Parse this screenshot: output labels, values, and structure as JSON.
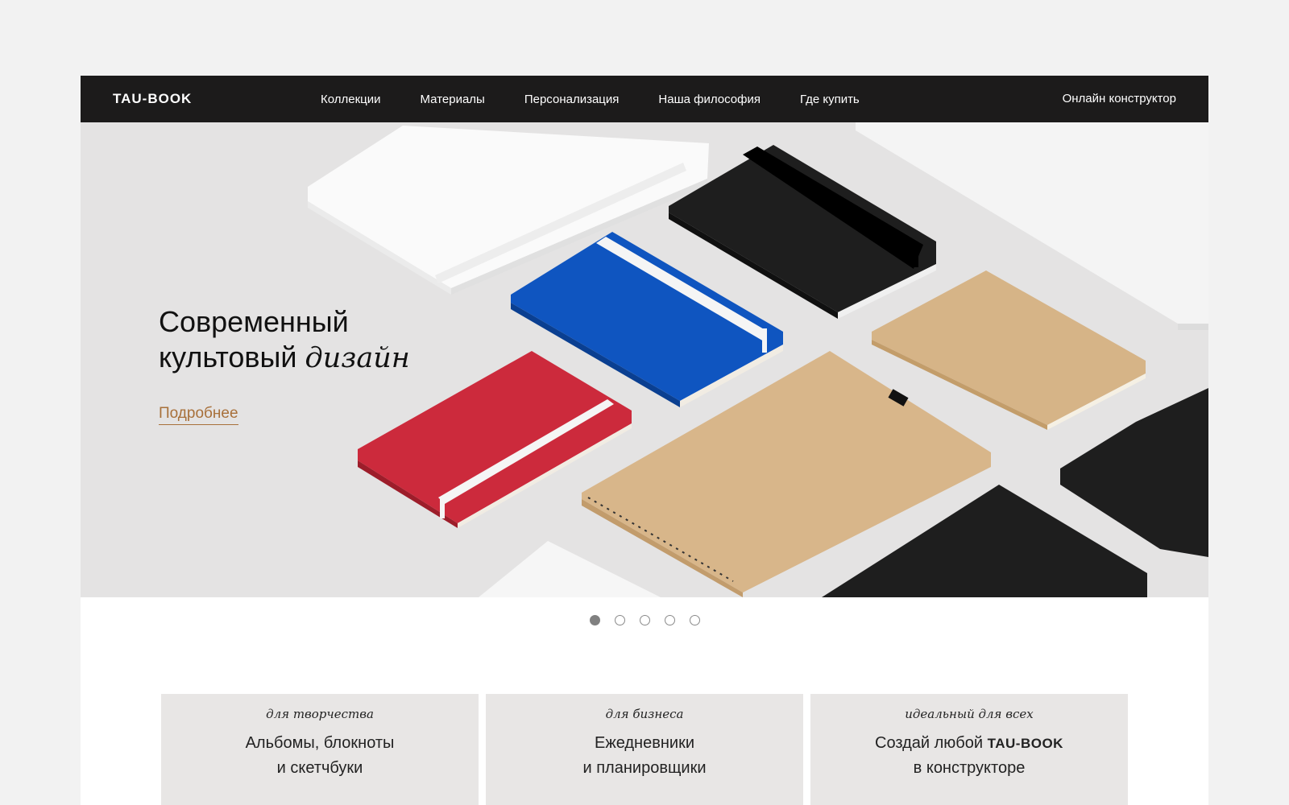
{
  "header": {
    "logo": "TAU-BOOK",
    "nav": [
      {
        "label": "Коллекции"
      },
      {
        "label": "Материалы"
      },
      {
        "label": "Персонализация"
      },
      {
        "label": "Наша философия"
      },
      {
        "label": "Где купить"
      }
    ],
    "cta": "Онлайн конструктор"
  },
  "hero": {
    "title_line1": "Современный",
    "title_line2_plain": "культовый ",
    "title_line2_italic": "дизайн",
    "more_link": "Подробнее",
    "slides_total": 5,
    "active_slide": 1
  },
  "cards": [
    {
      "tag": "для творчества",
      "title_line1": "Альбомы, блокноты",
      "title_line2": "и скетчбуки"
    },
    {
      "tag": "для бизнеса",
      "title_line1": "Ежедневники",
      "title_line2": "и планировщики"
    },
    {
      "tag": "идеальный для всех",
      "title_line1_prefix": "Создай любой ",
      "title_line1_brand": "TAU-BOOK",
      "title_line2": "в конструкторе"
    }
  ],
  "colors": {
    "nav_bg": "#1c1b1b",
    "hero_bg": "#e4e3e3",
    "accent_link": "#a8703a",
    "card_bg": "#e8e6e5",
    "notebook_blue": "#0f55c0",
    "notebook_red": "#cc2a3c",
    "kraft": "#d6b487",
    "black": "#1e1e1e"
  }
}
